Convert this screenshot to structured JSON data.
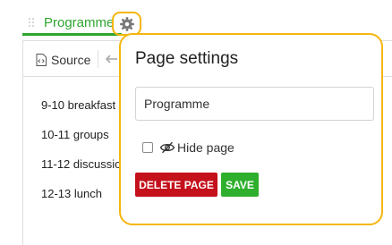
{
  "tab": {
    "label": "Programme",
    "settings_icon": "gear-icon",
    "active_color": "#2fa52f",
    "highlight_color": "#f5b60e"
  },
  "toolbar": {
    "source_label": "Source",
    "source_icon": "code-file-icon",
    "undo_icon": "undo-icon"
  },
  "content": {
    "lines": [
      "9-10 breakfast",
      "10-11 groups",
      "11-12 discussio",
      "12-13 lunch"
    ]
  },
  "page_settings": {
    "title": "Page settings",
    "page_name_value": "Programme",
    "hide_page_label": "Hide page",
    "hide_page_checked": false,
    "hide_page_icon": "eye-off-icon",
    "delete_label": "DELETE PAGE",
    "save_label": "SAVE",
    "delete_color": "#c4111b",
    "save_color": "#2eaf2e"
  }
}
